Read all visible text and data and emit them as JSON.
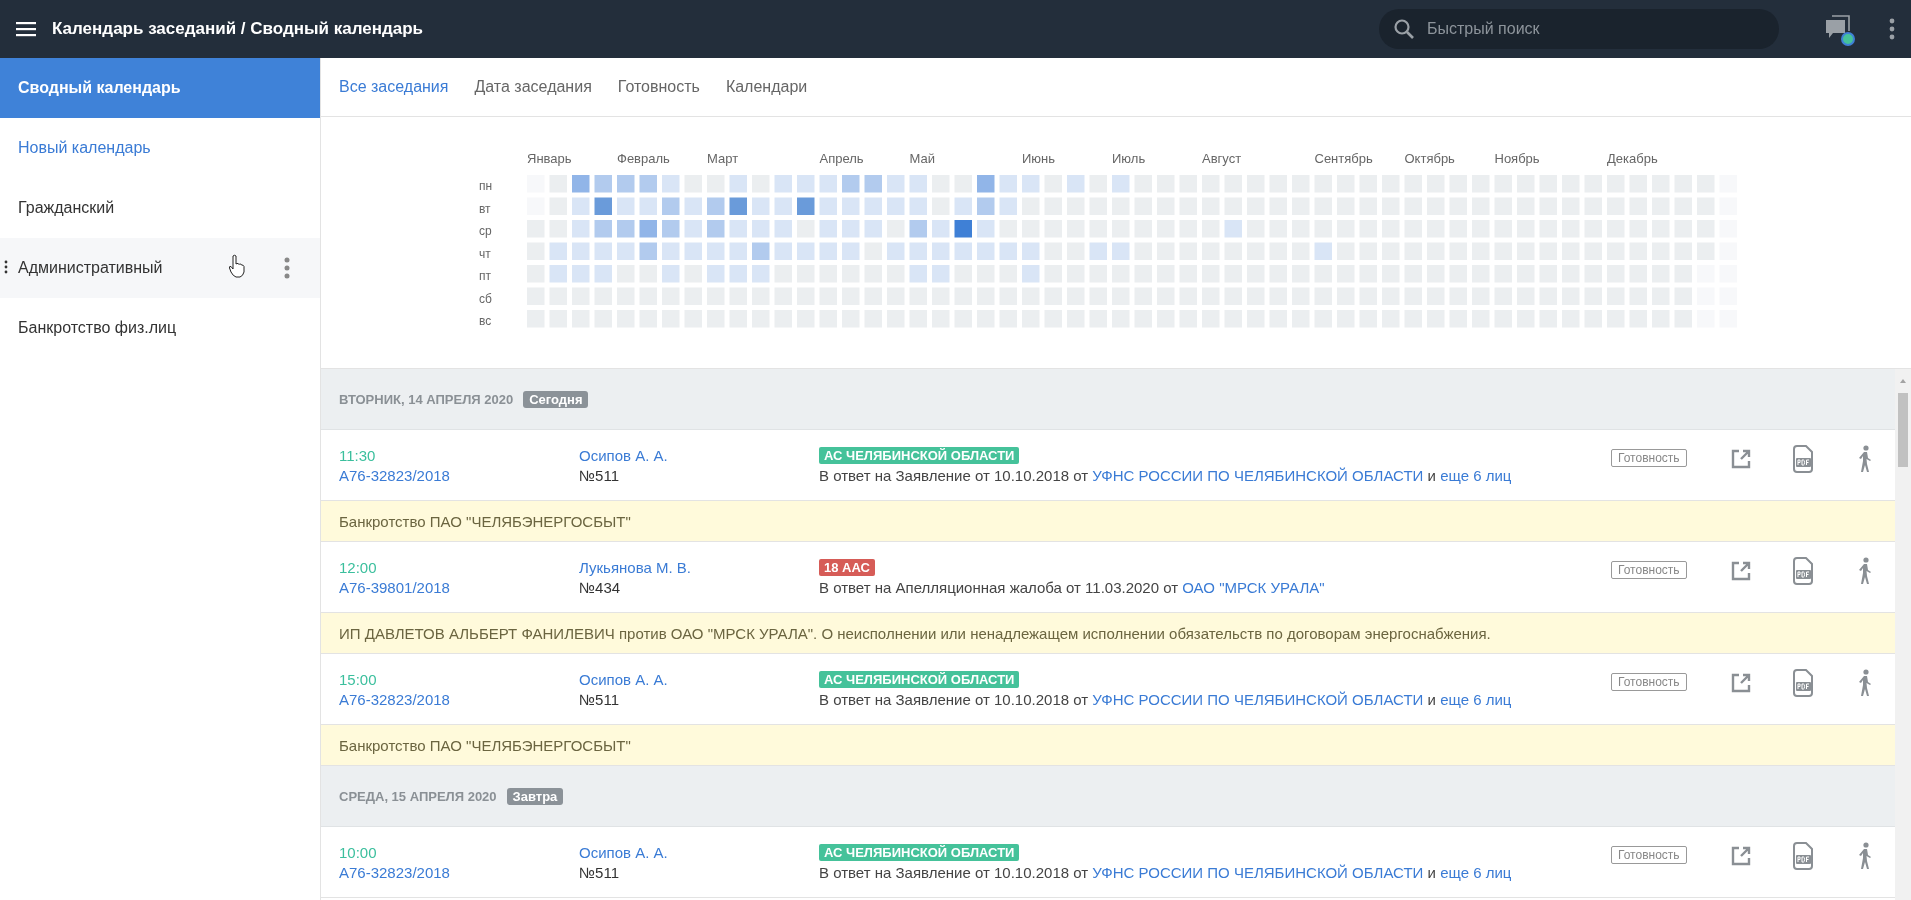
{
  "header": {
    "title": "Календарь заседаний / Сводный календарь",
    "search": {
      "placeholder": "Быстрый поиск"
    },
    "notification": true
  },
  "sidebar": {
    "items": [
      {
        "label": "Сводный календарь",
        "kind": "calendar",
        "selected": true,
        "hovered": false
      },
      {
        "label": "Новый календарь",
        "kind": "action",
        "selected": false,
        "hovered": false
      },
      {
        "label": "Гражданский",
        "kind": "calendar",
        "selected": false,
        "hovered": false
      },
      {
        "label": "Административный",
        "kind": "calendar",
        "selected": false,
        "hovered": true
      },
      {
        "label": "Банкротство физ.лиц",
        "kind": "calendar",
        "selected": false,
        "hovered": false
      }
    ]
  },
  "tabs": [
    {
      "label": "Все заседания",
      "selected": true
    },
    {
      "label": "Дата заседания",
      "selected": false
    },
    {
      "label": "Готовность",
      "selected": false
    },
    {
      "label": "Календари",
      "selected": false
    }
  ],
  "heatmap": {
    "months": [
      "Январь",
      "Февраль",
      "Март",
      "Апрель",
      "Май",
      "Июнь",
      "Июль",
      "Август",
      "Сентябрь",
      "Октябрь",
      "Ноябрь",
      "Декабрь"
    ],
    "weekdays": [
      "пн",
      "вт",
      "ср",
      "чт",
      "пт",
      "сб",
      "вс"
    ]
  },
  "days": [
    {
      "date": "ВТОРНИК, 14 АПРЕЛЯ 2020",
      "badge": "Сегодня",
      "meetings": [
        {
          "time": "11:30",
          "case": "А76-32823/2018",
          "judge": "Осипов А. А.",
          "number": "№511",
          "court": {
            "label": "АС ЧЕЛЯБИНСКОЙ ОБЛАСТИ",
            "color": "#45c29a"
          },
          "description": {
            "text": "В ответ на Заявление от 10.10.2018 от",
            "party": "УФНС РОССИИ ПО ЧЕЛЯБИНСКОЙ ОБЛАСТИ",
            "joiner": "и",
            "others": "еще 6 лиц"
          },
          "readiness": "Готовность",
          "note": "Банкротство ПАО \"ЧЕЛЯБЭНЕРГОСБЫТ\""
        },
        {
          "time": "12:00",
          "case": "А76-39801/2018",
          "judge": "Лукьянова М. В.",
          "number": "№434",
          "court": {
            "label": "18 ААС",
            "color": "#d65c57"
          },
          "description": {
            "text": "В ответ на Апелляционная жалоба от 11.03.2020 от",
            "party": "ОАО \"МРСК УРАЛА\""
          },
          "readiness": "Готовность",
          "note": "ИП ДАВЛЕТОВ АЛЬБЕРТ ФАНИЛЕВИЧ против ОАО \"МРСК УРАЛА\". О неисполнении или ненадлежащем исполнении обязательств по договорам энергоснабжения."
        },
        {
          "time": "15:00",
          "case": "А76-32823/2018",
          "judge": "Осипов А. А.",
          "number": "№511",
          "court": {
            "label": "АС ЧЕЛЯБИНСКОЙ ОБЛАСТИ",
            "color": "#45c29a"
          },
          "description": {
            "text": "В ответ на Заявление от 10.10.2018 от",
            "party": "УФНС РОССИИ ПО ЧЕЛЯБИНСКОЙ ОБЛАСТИ",
            "joiner": "и",
            "others": "еще 6 лиц"
          },
          "readiness": "Готовность",
          "note": "Банкротство ПАО \"ЧЕЛЯБЭНЕРГОСБЫТ\""
        }
      ]
    },
    {
      "date": "СРЕДА, 15 АПРЕЛЯ 2020",
      "badge": "Завтра",
      "meetings": [
        {
          "time": "10:00",
          "case": "А76-32823/2018",
          "judge": "Осипов А. А.",
          "number": "№511",
          "court": {
            "label": "АС ЧЕЛЯБИНСКОЙ ОБЛАСТИ",
            "color": "#45c29a"
          },
          "description": {
            "text": "В ответ на Заявление от 10.10.2018 от",
            "party": "УФНС РОССИИ ПО ЧЕЛЯБИНСКОЙ ОБЛАСТИ",
            "joiner": "и",
            "others": "еще 6 лиц"
          },
          "readiness": "Готовность"
        }
      ]
    }
  ]
}
